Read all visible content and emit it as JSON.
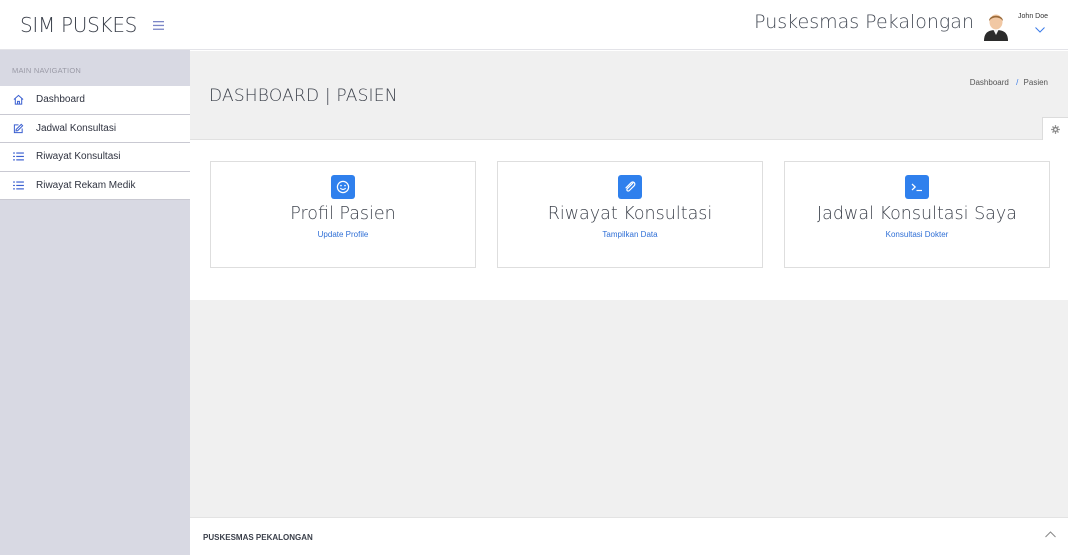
{
  "brand": {
    "title": "SIM PUSKES",
    "menu_icon": "hamburger-icon"
  },
  "header": {
    "org_name": "Puskesmas Pekalongan",
    "user_name": "John Doe",
    "user_menu_icon": "chevron-down-icon"
  },
  "sidebar": {
    "section_label": "MAIN NAVIGATION",
    "items": [
      {
        "label": "Dashboard",
        "icon": "home-icon"
      },
      {
        "label": "Jadwal Konsultasi",
        "icon": "edit-icon"
      },
      {
        "label": "Riwayat Konsultasi",
        "icon": "list-icon"
      },
      {
        "label": "Riwayat Rekam Medik",
        "icon": "list-icon"
      }
    ]
  },
  "page": {
    "title": "DASHBOARD | PASIEN",
    "breadcrumb": [
      "Dashboard",
      "Pasien"
    ],
    "settings_icon": "gear-icon"
  },
  "cards": [
    {
      "title": "Profil Pasien",
      "link": "Update Profile",
      "icon": "smiley-icon"
    },
    {
      "title": "Riwayat Konsultasi",
      "link": "Tampilkan Data",
      "icon": "paperclip-icon"
    },
    {
      "title": "Jadwal Konsultasi Saya",
      "link": "Konsultasi Dokter",
      "icon": "terminal-icon"
    }
  ],
  "footer": {
    "text": "PUSKESMAS PEKALONGAN",
    "toggle_icon": "chevron-up-icon"
  },
  "colors": {
    "accent": "#2f80ed",
    "sidebar_bg": "#d8d9e3",
    "band_bg": "#f0f0f0"
  }
}
